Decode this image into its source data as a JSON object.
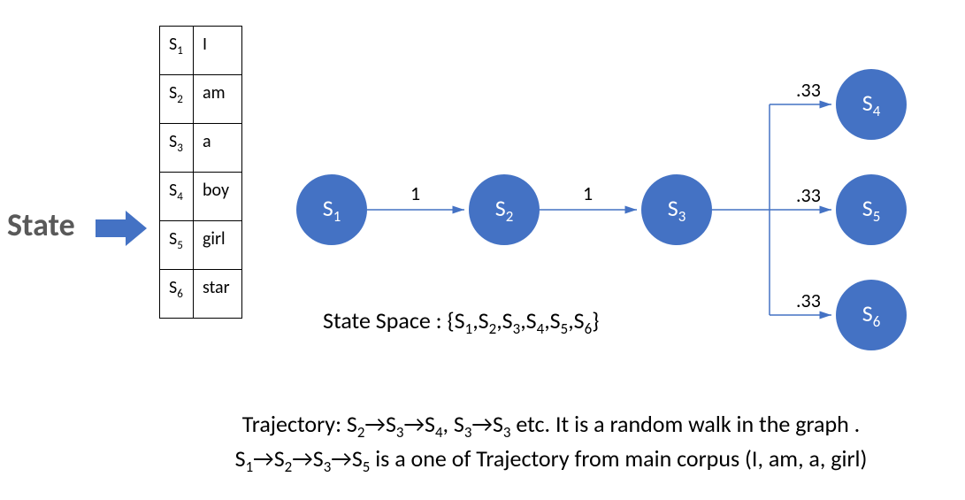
{
  "labels": {
    "state": "State",
    "state_space_prefix": "State Space : "
  },
  "states": [
    {
      "id": "S",
      "sub": "1",
      "word": "I"
    },
    {
      "id": "S",
      "sub": "2",
      "word": "am"
    },
    {
      "id": "S",
      "sub": "3",
      "word": "a"
    },
    {
      "id": "S",
      "sub": "4",
      "word": "boy"
    },
    {
      "id": "S",
      "sub": "5",
      "word": "girl"
    },
    {
      "id": "S",
      "sub": "6",
      "word": "star"
    }
  ],
  "state_space": [
    "S1",
    "S2",
    "S3",
    "S4",
    "S5",
    "S6"
  ],
  "nodes": {
    "n1": {
      "letter": "S",
      "sub": "1"
    },
    "n2": {
      "letter": "S",
      "sub": "2"
    },
    "n3": {
      "letter": "S",
      "sub": "3"
    },
    "n4": {
      "letter": "S",
      "sub": "4"
    },
    "n5": {
      "letter": "S",
      "sub": "5"
    },
    "n6": {
      "letter": "S",
      "sub": "6"
    }
  },
  "edges": {
    "e12": "1",
    "e23": "1",
    "e34": ".33",
    "e35": ".33",
    "e36": ".33"
  },
  "trajectory": {
    "line1_a": "Trajectory: S",
    "line1_sub_a": "2",
    "line1_b": "S",
    "line1_sub_b": "3",
    "line1_c": "S",
    "line1_sub_c": "4",
    "line1_d": ", S",
    "line1_sub_d": "3",
    "line1_e": "S",
    "line1_sub_e": "3",
    "line1_f": " etc. It is a random walk in the graph .",
    "line2_a": "S",
    "line2_sub_a": "1",
    "line2_b": "S",
    "line2_sub_b": "2",
    "line2_c": "S",
    "line2_sub_c": "3",
    "line2_d": "S",
    "line2_sub_d": "5",
    "line2_e": "  is a one of  Trajectory from main corpus (I, am, a, girl)"
  },
  "chart_data": {
    "type": "graph",
    "nodes": [
      "S1",
      "S2",
      "S3",
      "S4",
      "S5",
      "S6"
    ],
    "edges": [
      {
        "from": "S1",
        "to": "S2",
        "weight": 1
      },
      {
        "from": "S2",
        "to": "S3",
        "weight": 1
      },
      {
        "from": "S3",
        "to": "S4",
        "weight": 0.33
      },
      {
        "from": "S3",
        "to": "S5",
        "weight": 0.33
      },
      {
        "from": "S3",
        "to": "S6",
        "weight": 0.33
      }
    ],
    "state_words": {
      "S1": "I",
      "S2": "am",
      "S3": "a",
      "S4": "boy",
      "S5": "girl",
      "S6": "star"
    },
    "trajectory_examples": [
      [
        "S2",
        "S3",
        "S4"
      ],
      [
        "S3",
        "S3"
      ]
    ],
    "main_corpus_trajectory": [
      "S1",
      "S2",
      "S3",
      "S5"
    ],
    "main_corpus_words": [
      "I",
      "am",
      "a",
      "girl"
    ]
  }
}
